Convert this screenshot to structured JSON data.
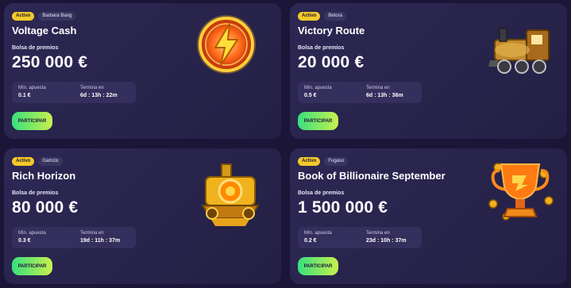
{
  "cards": [
    {
      "status": "Activo",
      "provider": "Barbara Bang",
      "title": "Voltage Cash",
      "pool_label": "Bolsa de premios",
      "pool_amount": "250 000 €",
      "min_bet_label": "Mín. apuesta",
      "min_bet": "0.1 €",
      "ends_label": "Termina en",
      "ends_in": "6d : 13h : 22m",
      "button": "PARTICIPAR",
      "art": "lightning-coin-icon"
    },
    {
      "status": "Activo",
      "provider": "Betora",
      "title": "Victory Route",
      "pool_label": "Bolsa de premios",
      "pool_amount": "20 000 €",
      "min_bet_label": "Mín. apuesta",
      "min_bet": "0.5 €",
      "ends_label": "Termina en",
      "ends_in": "6d : 13h : 36m",
      "button": "PARTICIPAR",
      "art": "steam-train-icon"
    },
    {
      "status": "Activo",
      "provider": "Gamzix",
      "title": "Rich Horizon",
      "pool_label": "Bolsa de premios",
      "pool_amount": "80 000 €",
      "min_bet_label": "Mín. apuesta",
      "min_bet": "0.3 €",
      "ends_label": "Termina en",
      "ends_in": "19d : 11h : 37m",
      "button": "PARTICIPAR",
      "art": "gold-train-icon"
    },
    {
      "status": "Activo",
      "provider": "Fugaso",
      "title": "Book of Billionaire September",
      "pool_label": "Bolsa de premios",
      "pool_amount": "1 500 000 €",
      "min_bet_label": "Mín. apuesta",
      "min_bet": "0.2 €",
      "ends_label": "Termina en",
      "ends_in": "23d : 10h : 37m",
      "button": "PARTICIPAR",
      "art": "trophy-icon"
    }
  ],
  "colors": {
    "background": "#1b1638",
    "card": "#2a2550",
    "active_badge": "#f4c82a",
    "button_start": "#37e07e",
    "button_end": "#c8f04e"
  }
}
